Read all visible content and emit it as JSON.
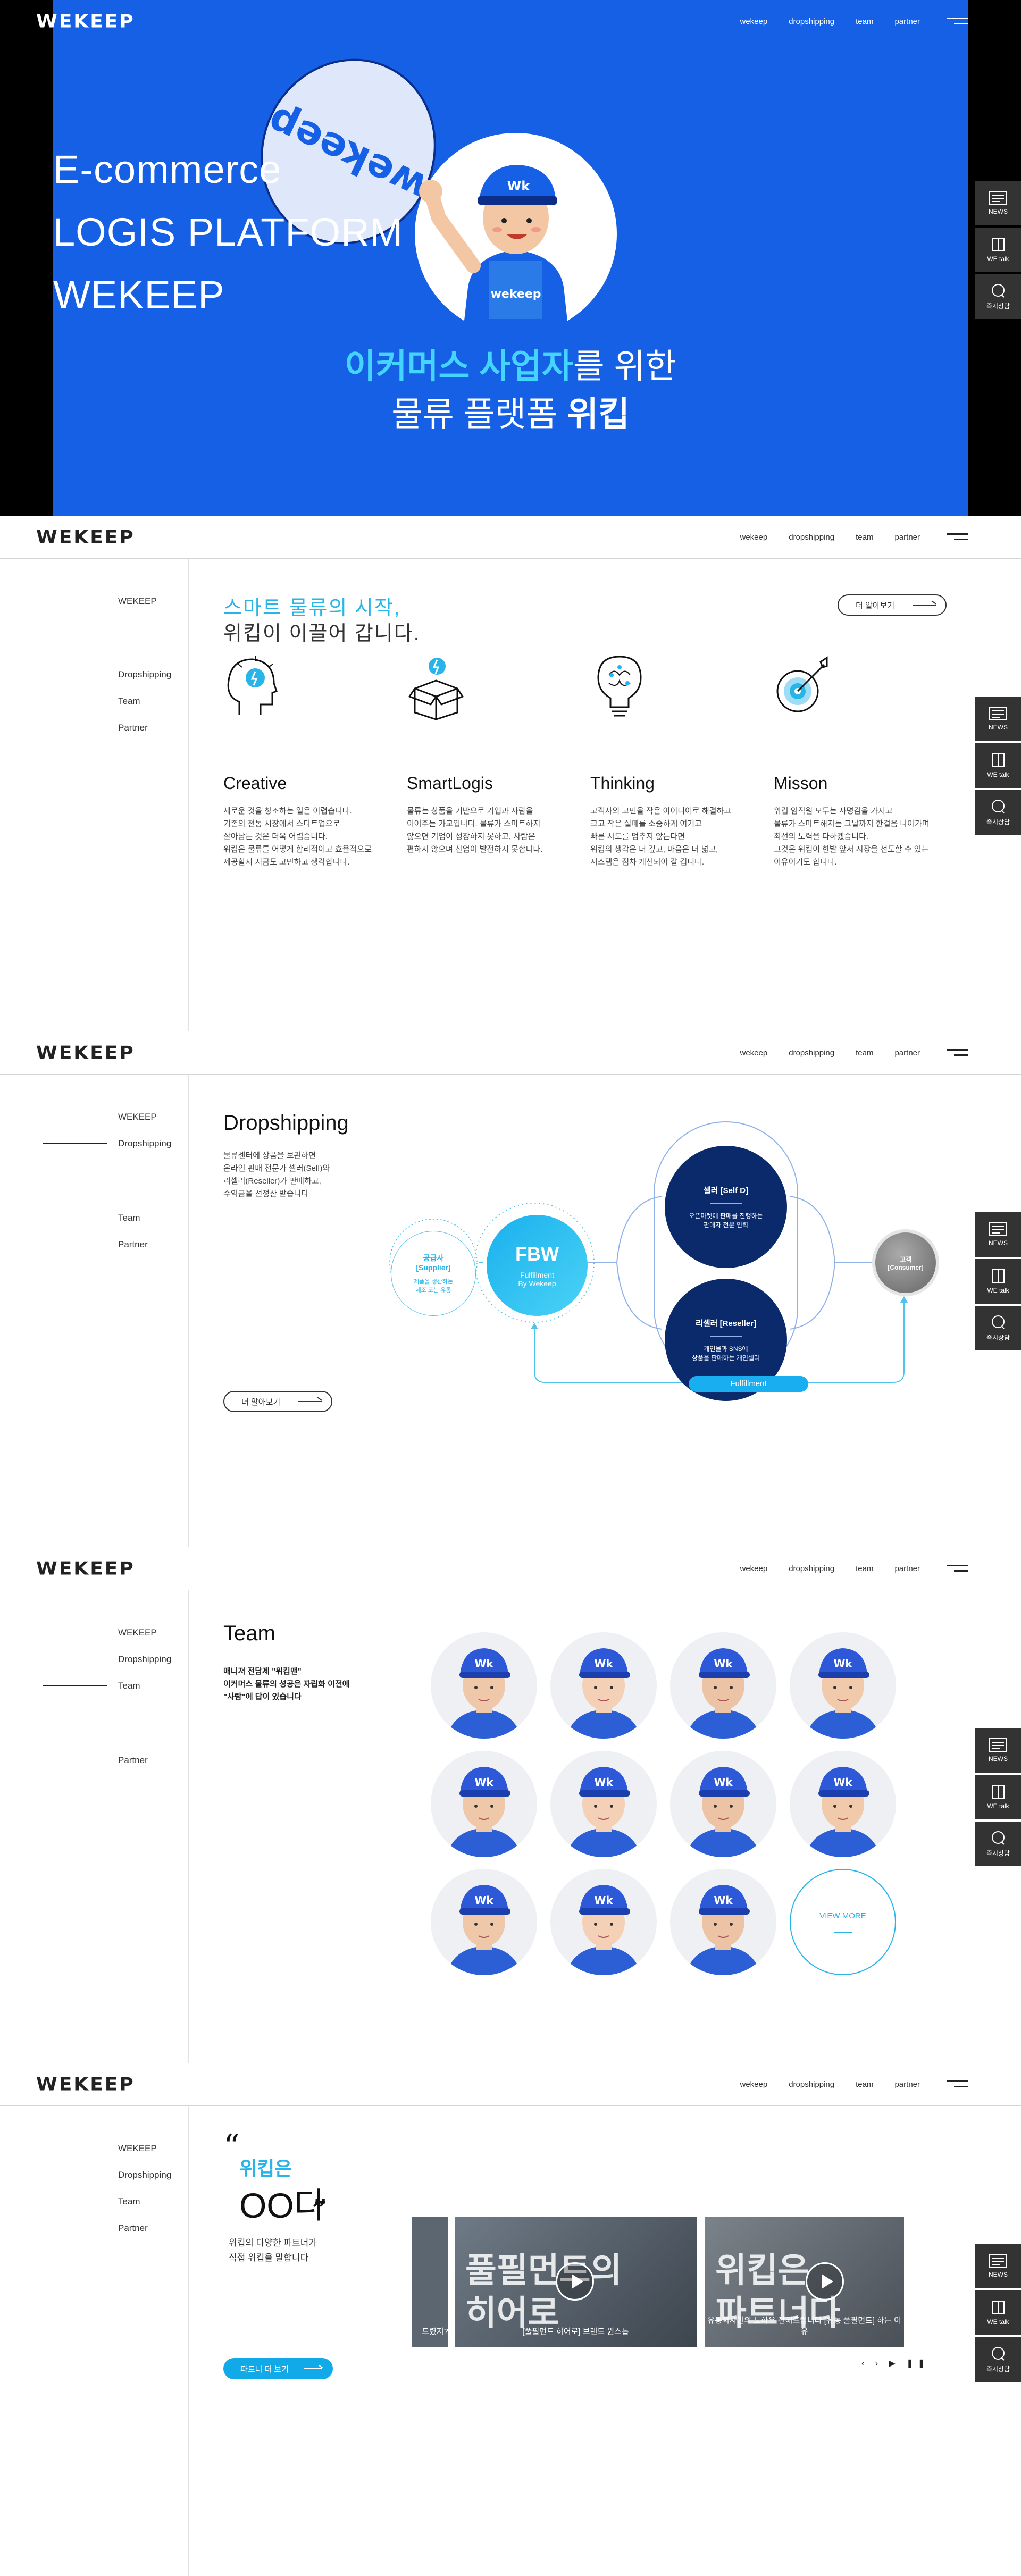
{
  "brand": {
    "logo": "WEKEEP"
  },
  "nav": {
    "items": [
      "wekeep",
      "dropshipping",
      "team",
      "partner"
    ]
  },
  "float": {
    "news": "NEWS",
    "wetalk": "WE talk",
    "consult": "즉시상담"
  },
  "hero": {
    "lines": [
      "E-commerce",
      "LOGIS PLATFORM",
      "WEKEEP"
    ],
    "kor1_highlight": "이커머스 사업자",
    "kor1_rest": "를 위한",
    "kor2_prefix": "물류 플랫폼 ",
    "kor2_bold": "위킵",
    "balloon_text": "wekeep",
    "mascot_cap": "Wk",
    "mascot_shirt": "wekeep"
  },
  "sidenav": [
    "WEKEEP",
    "Dropshipping",
    "Team",
    "Partner"
  ],
  "intro": {
    "headline_blue": "스마트 물류의 시작,",
    "headline_dark": "위킵이 이끌어 갑니다.",
    "more": "더 알아보기",
    "cards": [
      {
        "title": "Creative",
        "desc": "새로운 것을 창조하는 일은 어렵습니다.\n기존의 전통 시장에서 스타트업으로\n살아남는 것은 더욱 어렵습니다.\n위킵은 물류를 어떻게 합리적이고 효율적으로\n제공할지 지금도 고민하고 생각합니다.",
        "icon": "lightbulb-head-icon"
      },
      {
        "title": "SmartLogis",
        "desc": "물류는 상품을 기반으로 기업과 사람을\n이어주는 가교입니다. 물류가 스마트하지\n않으면 기업이 성장하지 못하고, 사람은\n편하지 않으며 산업이 발전하지 못합니다.",
        "icon": "smart-box-icon"
      },
      {
        "title": "Thinking",
        "desc": "고객사의 고민을 작은 아이디어로 해결하고\n크고 작은 실패를 소중하게 여기고\n빠른 시도를 멈추지 않는다면\n위킵의 생각은 더 깊고, 마음은 더 넓고,\n시스템은 점차 개선되어 갈 겁니다.",
        "icon": "brain-bulb-icon"
      },
      {
        "title": "Misson",
        "desc": "위킵 임직원 모두는 사명감을 가지고\n물류가 스마트해지는 그날까지 한걸음 나아가며\n최선의 노력을 다하겠습니다.\n그것은 위킵이 한발 앞서 시장을 선도할 수 있는\n이유이기도 합니다.",
        "icon": "target-arrow-icon"
      }
    ]
  },
  "dropship": {
    "title": "Dropshipping",
    "desc": "물류센터에 상품을 보관하면\n온라인 판매 전문가 셀러(Self)와\n리셀러(Reseller)가 판매하고,\n수익금을 선정산 받습니다",
    "more": "더 알아보기",
    "supplier_t": "공급사\n[Supplier]",
    "supplier_d": "제품을 생산하는\n제조 또는 유통",
    "fbw_t": "FBW",
    "fbw_d": "Fulfillment\nBy Wekeep",
    "seller_t": "셀러 [Self D]",
    "seller_d": "오픈마켓에 판매를 진행하는\n판매자 전문 인력",
    "reseller_t": "리셀러 [Reseller]",
    "reseller_d": "개인몰과 SNS에\n상품을 판매하는 개인셀러",
    "consumer_t": "고객\n[Consumer]",
    "fulfill": "Fulfillment"
  },
  "team": {
    "title": "Team",
    "desc": "매니저 전담제 \"위킵맨\"\n이커머스 물류의 성공은 자립화 이전에\n\"사람\"에 답이 있습니다",
    "viewmore": "VIEW MORE",
    "cap": "Wk"
  },
  "partner": {
    "k1": "위킵은",
    "k2": "OO다",
    "desc": "위킵의 다양한 파트너가\n직접 위킵을 말합니다",
    "btn": "파트너 더 보기",
    "videos": [
      {
        "big": "",
        "caption": "드렸지?"
      },
      {
        "big": "풀필먼트의\n히어로",
        "caption": "[풀필먼트 히어로] 브랜드 원스톱"
      },
      {
        "big": "위킵은\n파트너다",
        "caption": "유통회사만의 노하우 전해드립니다 [유통 풀필먼트] 하는 이유"
      }
    ],
    "controls": "‹ › ▶ ❚❚"
  },
  "colors": {
    "hero_blue": "#1660e6",
    "accent": "#28b4e8",
    "navy": "#0a2a6b"
  }
}
